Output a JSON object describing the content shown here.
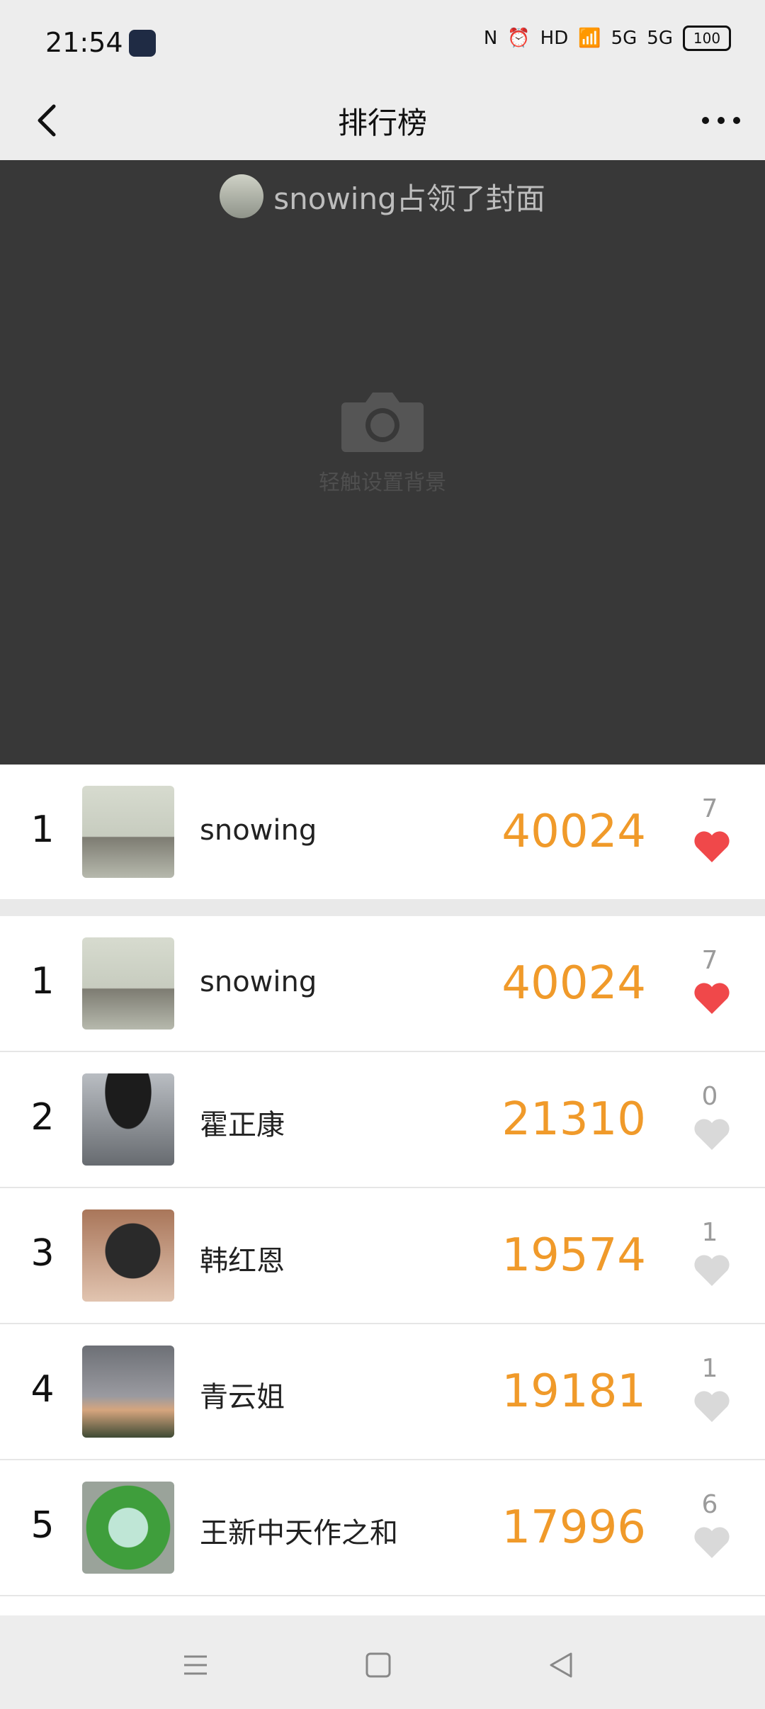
{
  "status_bar": {
    "time": "21:54",
    "network": "5G",
    "battery": "100"
  },
  "nav": {
    "title": "排行榜"
  },
  "cover": {
    "owner_text": "snowing占领了封面",
    "hint": "轻触设置背景"
  },
  "top_entry": {
    "rank": "1",
    "name": "snowing",
    "score": "40024",
    "likes": "7",
    "liked": true
  },
  "rankings": [
    {
      "rank": "1",
      "name": "snowing",
      "score": "40024",
      "likes": "7",
      "liked": true
    },
    {
      "rank": "2",
      "name": "霍正康",
      "score": "21310",
      "likes": "0",
      "liked": false
    },
    {
      "rank": "3",
      "name": "韩红恩",
      "score": "19574",
      "likes": "1",
      "liked": false
    },
    {
      "rank": "4",
      "name": "青云姐",
      "score": "19181",
      "likes": "1",
      "liked": false
    },
    {
      "rank": "5",
      "name": "王新中天作之和",
      "score": "17996",
      "likes": "6",
      "liked": false
    }
  ],
  "colors": {
    "score": "#f09a2a",
    "heart_active": "#f0484a",
    "heart_inactive": "#d9d9d9",
    "cover_bg": "#383838"
  }
}
